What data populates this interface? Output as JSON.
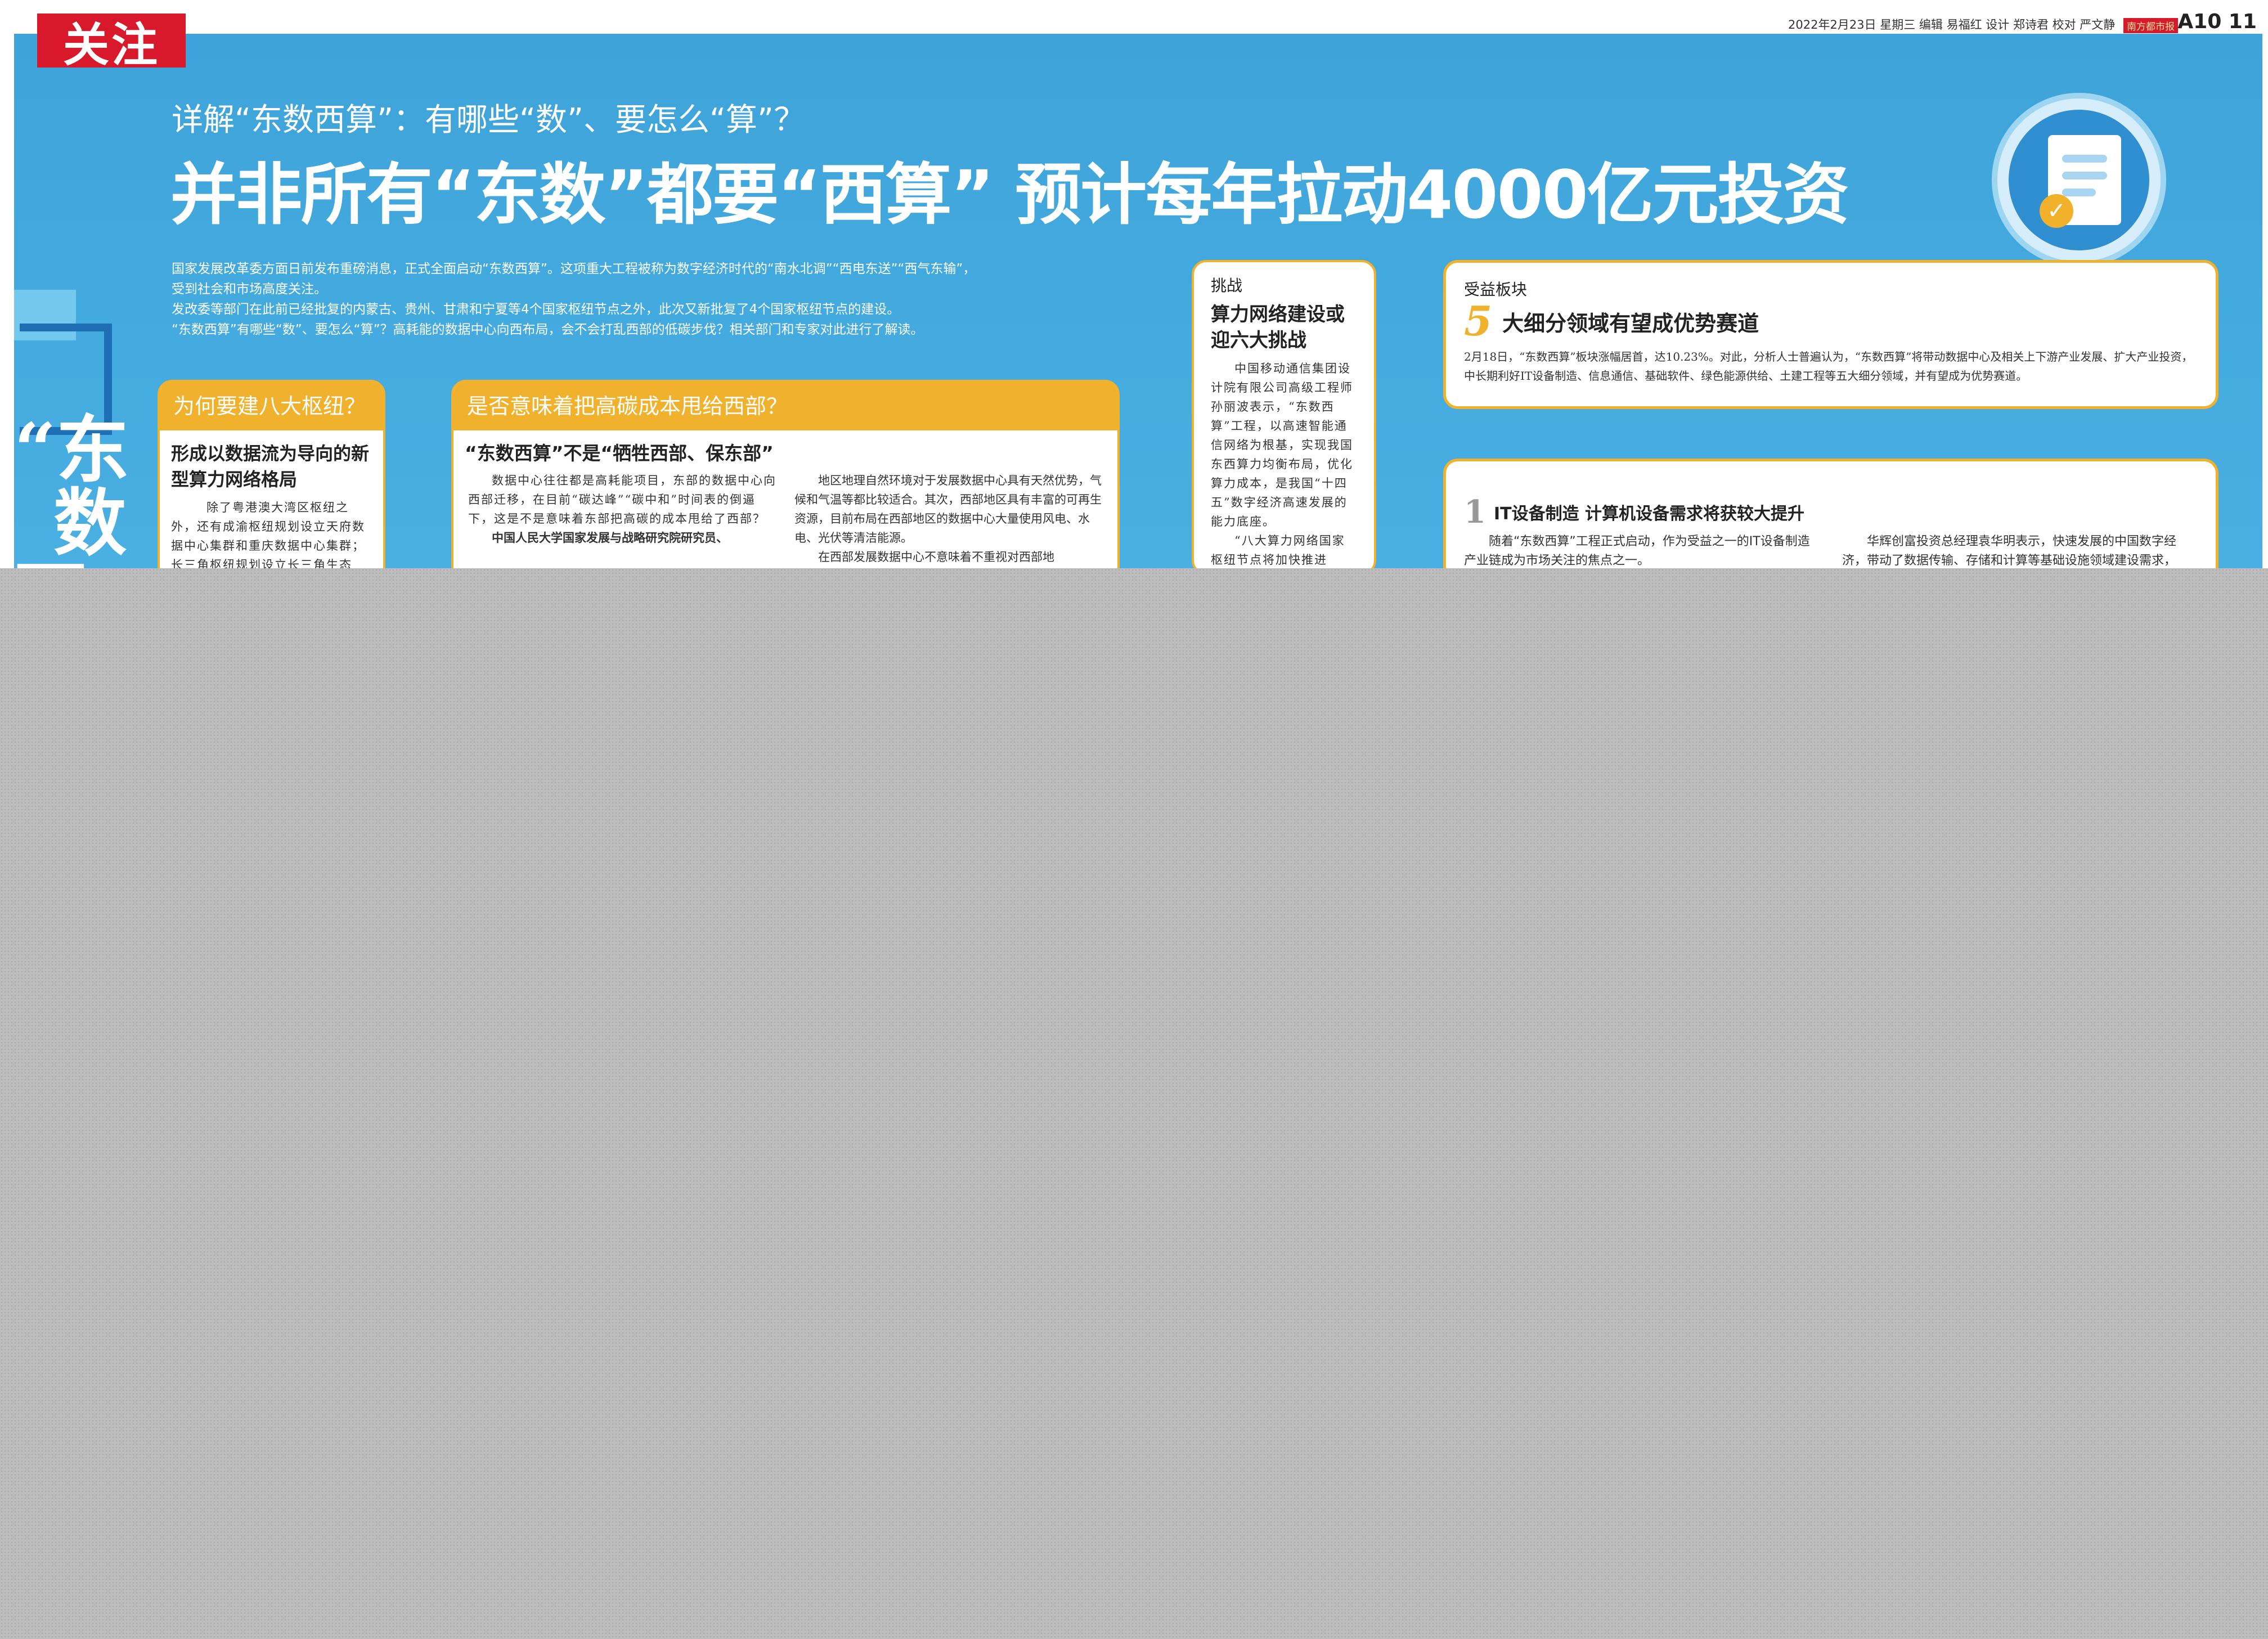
{
  "section_tag": "关注",
  "meta": {
    "date_line": "2022年2月23日  星期三  编辑 易福红  设计 郑诗君  校对 严文静",
    "paper_logo": "南方都市报",
    "page_number": "A10 11"
  },
  "vertical_title": [
    "“东",
    "数",
    "西"
  ],
  "subtitle": "详解“东数西算”：有哪些“数”、要怎么“算”？",
  "headline": "并非所有“东数”都要“西算”    预计每年拉动4000亿元投资",
  "intro": [
    "国家发展改革委方面日前发布重磅消息，正式全面启动“东数西算”。这项重大工程被称为数字经济时代的“南水北调”“西电东送”“西气东输”，受到社会和市场高度关注。",
    "发改委等部门在此前已经批复的内蒙古、贵州、甘肃和宁夏等4个国家枢纽节点之外，此次又新批复了4个国家枢纽节点的建设。",
    "“东数西算”有哪些“数”、要怎么“算”？高耗能的数据中心向西布局，会不会打乱西部的低碳步伐？相关部门和专家对此进行了解读。"
  ],
  "card1": {
    "header": "为何要建八大枢纽？",
    "title": "形成以数据流为导向的新型算力网络格局",
    "body": "除了粤港澳大湾区枢纽之外，还有成渝枢纽规划设立天府数据中心集群和重庆数据中心集群；长三角枢纽规划设立长三角生态"
  },
  "card2": {
    "header": "是否意味着把高碳成本甩给西部？",
    "title": "“东数西算”不是“牺牲西部、保东部”",
    "col1_p1": "数据中心往往都是高耗能项目，东部的数据中心向西部迁移，在目前“碳达峰”“碳中和”时间表的倒逼下，这是不是意味着东部把高碳的成本甩给了西部？",
    "col1_p2": "中国人民大学国家发展与战略研究院研究员、",
    "col2_p1": "地区地理自然环境对于发展数据中心具有天然优势，气候和气温等都比较适合。其次，西部地区具有丰富的可再生资源，目前布局在西部地区的数据中心大量使用风电、水电、光伏等清洁能源。",
    "col2_p2": "在西部发展数据中心不意味着不重视对西部地"
  },
  "card3": {
    "label": "挑战",
    "title": "算力网络建设或迎六大挑战",
    "body_p1": "中国移动通信集团设计院有限公司高级工程师孙丽波表示，“东数西算”工程，以高速智能通信网络为根基，实现我国东西算力均衡布局，优化算力成本，是我国“十四五”数字经济高速发展的能力底座。",
    "body_p2": "“八大算力网络国家枢纽节点将加快推进"
  },
  "card4": {
    "label": "受益板块",
    "number": "5",
    "title": "大细分领域有望成优势赛道",
    "body": "2月18日，“东数西算”板块涨幅居首，达10.23%。对此，分析人士普遍认为，“东数西算”将带动数据中心及相关上下游产业发展、扩大产业投资，中长期利好IT设备制造、信息通信、基础软件、绿色能源供给、土建工程等五大细分领域，并有望成为优势赛道。"
  },
  "card5": {
    "number": "1",
    "title": "IT设备制造    计算机设备需求将获较大提升",
    "col1": "随着“东数西算”工程正式启动，作为受益之一的IT设备制造产业链成为市场关注的焦点之一。",
    "col2": "华辉创富投资总经理袁华明表示，快速发展的中国数字经济，带动了数据传输、存储和计算等基础设施领域建设需求，"
  },
  "colors": {
    "accent_red": "#d8182b",
    "panel_blue": "#44abe0",
    "card_yellow": "#f0b12c"
  }
}
